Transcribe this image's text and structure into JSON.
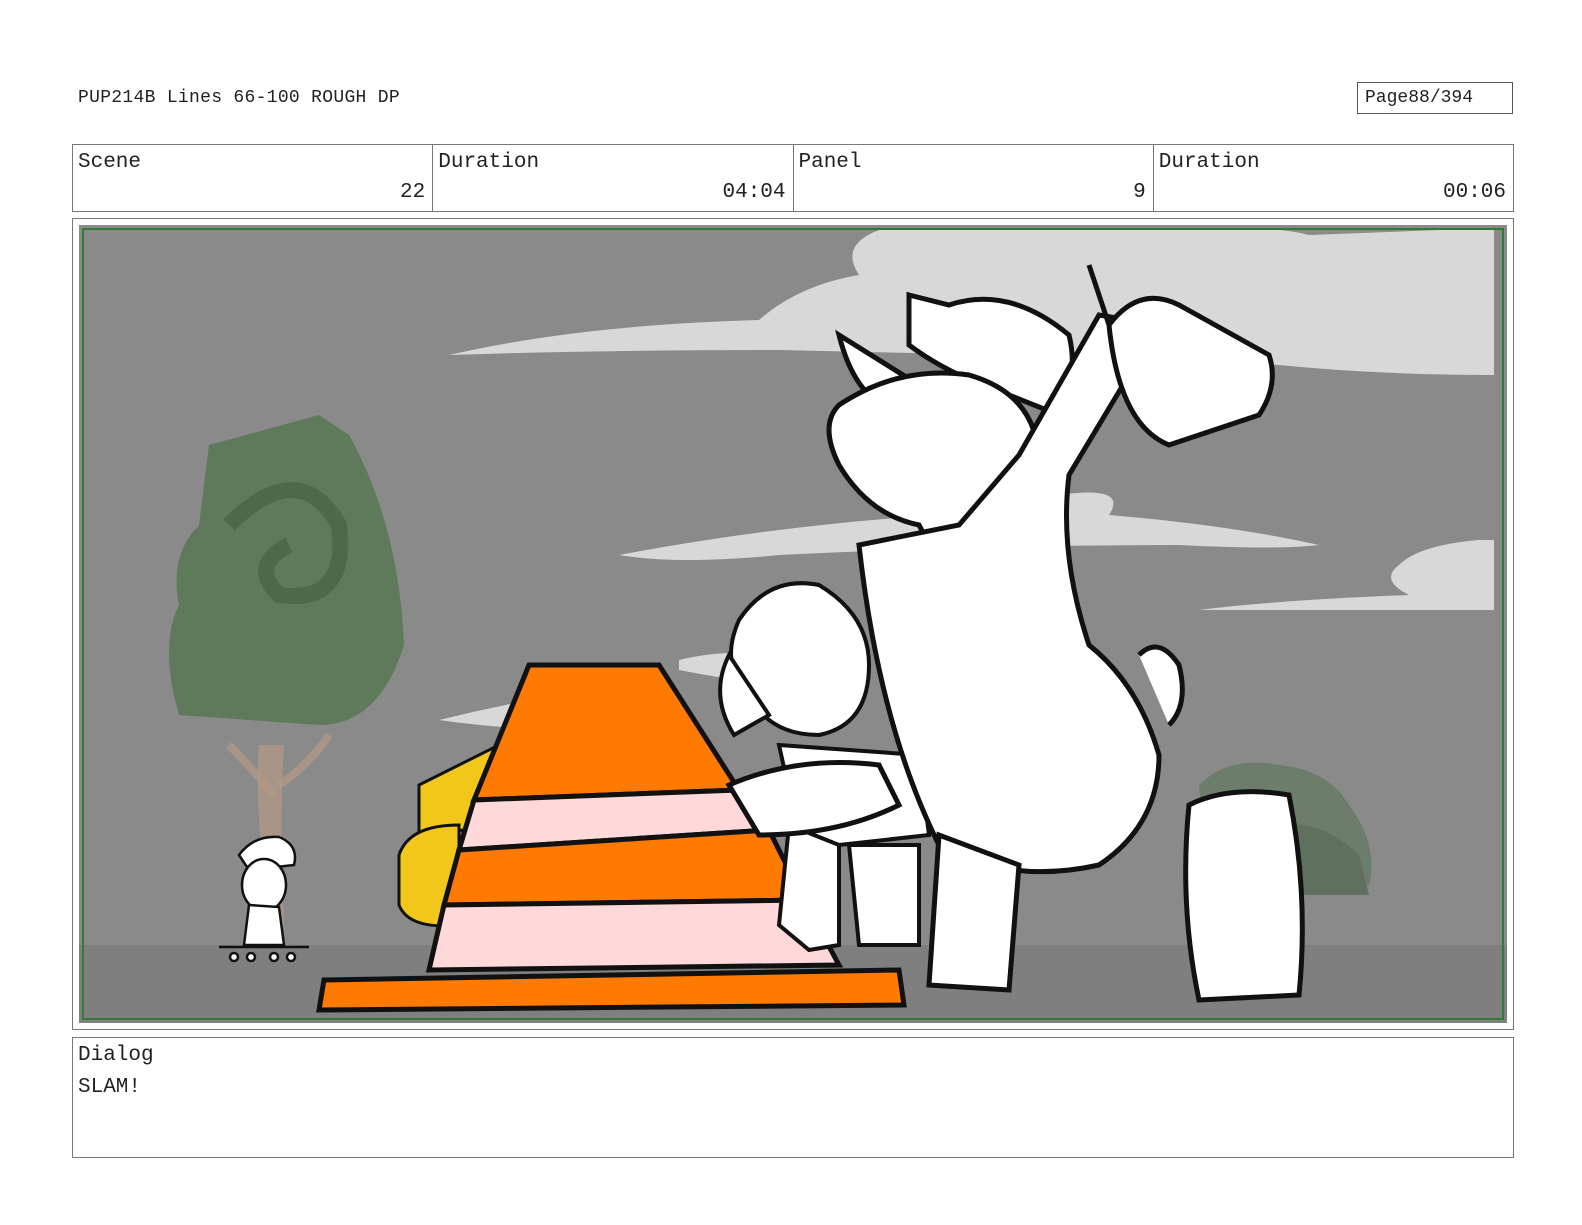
{
  "header": {
    "document_title": "PUP214B Lines 66-100 ROUGH DP",
    "page_label": "Page",
    "page_number": "88/394"
  },
  "info": {
    "scene_label": "Scene",
    "scene_value": "22",
    "scene_duration_label": "Duration",
    "scene_duration_value": "04:04",
    "panel_label": "Panel",
    "panel_value": "9",
    "panel_duration_label": "Duration",
    "panel_duration_value": "00:06"
  },
  "panel_image": {
    "frame_color": "#2e7d32",
    "background_color": "#8a8a8a",
    "cone_orange": "#ff7a00",
    "cone_pink": "#ffd9d9"
  },
  "dialog": {
    "label": "Dialog",
    "text": "SLAM!"
  }
}
